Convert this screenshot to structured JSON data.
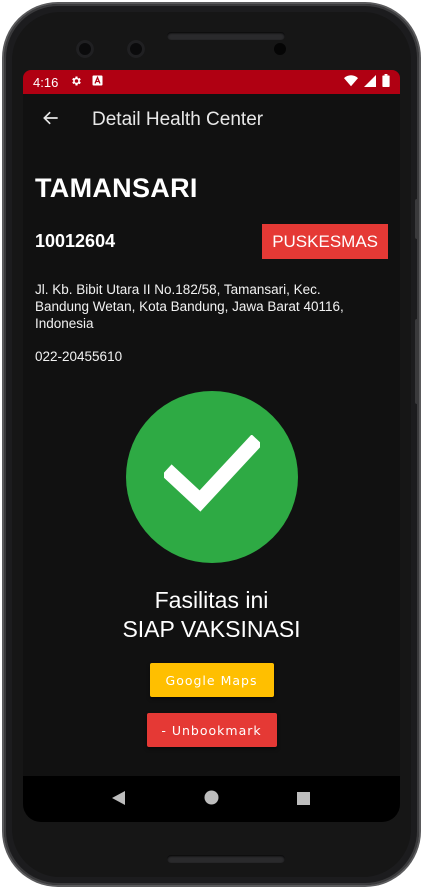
{
  "status_bar": {
    "time": "4:16",
    "icons": [
      "gear-icon",
      "font-a-icon",
      "wifi-icon",
      "signal-icon",
      "battery-icon"
    ]
  },
  "app_bar": {
    "title": "Detail Health Center",
    "back_icon": "arrow-back-icon"
  },
  "health_center": {
    "name": "TAMANSARI",
    "code": "10012604",
    "type": "PUSKESMAS",
    "address": "Jl. Kb. Bibit Utara II No.182/58, Tamansari, Kec. Bandung Wetan, Kota Bandung, Jawa Barat 40116, Indonesia",
    "phone": "022-20455610"
  },
  "status": {
    "icon": "check-icon",
    "line1": "Fasilitas ini",
    "line2": "SIAP VAKSINASI"
  },
  "buttons": {
    "maps_label": "Google Maps",
    "unbookmark_label": "- Unbookmark"
  },
  "nav_bar": {
    "icons": [
      "back-triangle-icon",
      "home-circle-icon",
      "recents-square-icon"
    ]
  },
  "colors": {
    "status_bar": "#b00012",
    "background": "#111111",
    "badge": "#e53935",
    "check_circle": "#2eaa44",
    "maps_button": "#ffbf00",
    "unbookmark_button": "#e53935"
  }
}
